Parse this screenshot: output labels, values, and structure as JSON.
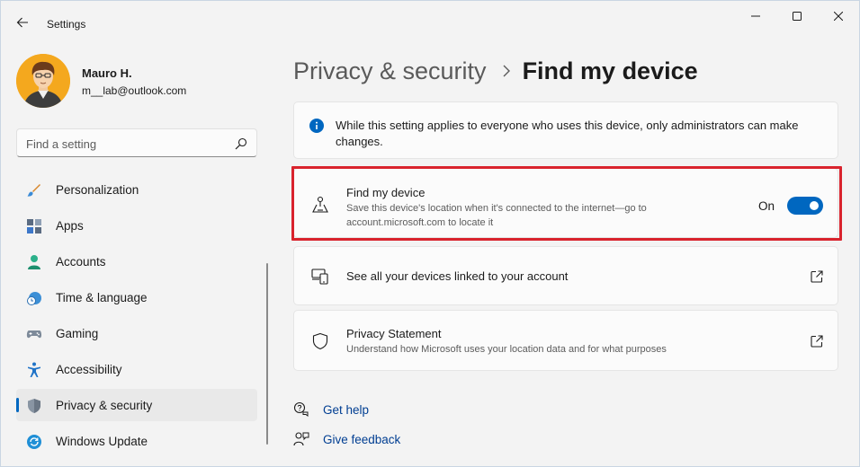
{
  "window": {
    "title": "Settings"
  },
  "user": {
    "name": "Mauro H.",
    "email": "m__lab@outlook.com"
  },
  "search": {
    "placeholder": "Find a setting"
  },
  "sidebar": {
    "items": [
      {
        "label": "Personalization",
        "icon": "paint-brush-icon"
      },
      {
        "label": "Apps",
        "icon": "apps-icon"
      },
      {
        "label": "Accounts",
        "icon": "person-icon"
      },
      {
        "label": "Time & language",
        "icon": "clock-globe-icon"
      },
      {
        "label": "Gaming",
        "icon": "gamepad-icon"
      },
      {
        "label": "Accessibility",
        "icon": "accessibility-icon"
      },
      {
        "label": "Privacy & security",
        "icon": "shield-icon",
        "active": true
      },
      {
        "label": "Windows Update",
        "icon": "sync-icon"
      }
    ]
  },
  "breadcrumb": {
    "parent": "Privacy & security",
    "current": "Find my device"
  },
  "info": {
    "text": "While this setting applies to everyone who uses this device, only administrators can make changes."
  },
  "find_device": {
    "title": "Find my device",
    "description": "Save this device's location when it's connected to the internet—go to account.microsoft.com to locate it",
    "state_label": "On",
    "enabled": true
  },
  "devices_link": {
    "title": "See all your devices linked to your account"
  },
  "privacy_statement": {
    "title": "Privacy Statement",
    "description": "Understand how Microsoft uses your location data and for what purposes"
  },
  "help": {
    "get_help": "Get help",
    "give_feedback": "Give feedback"
  },
  "colors": {
    "accent": "#0067c0",
    "highlight": "#d9232d"
  }
}
